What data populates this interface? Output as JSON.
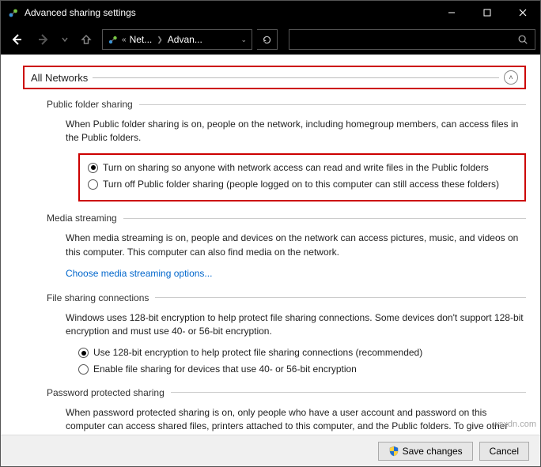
{
  "window": {
    "title": "Advanced sharing settings"
  },
  "nav": {
    "breadcrumb": {
      "part1": "Net...",
      "part2": "Advan..."
    }
  },
  "accordion": {
    "title": "All Networks"
  },
  "sections": {
    "public_folder": {
      "title": "Public folder sharing",
      "desc": "When Public folder sharing is on, people on the network, including homegroup members, can access files in the Public folders.",
      "opt_on": "Turn on sharing so anyone with network access can read and write files in the Public folders",
      "opt_off": "Turn off Public folder sharing (people logged on to this computer can still access these folders)"
    },
    "media": {
      "title": "Media streaming",
      "desc": "When media streaming is on, people and devices on the network can access pictures, music, and videos on this computer. This computer can also find media on the network.",
      "link": "Choose media streaming options..."
    },
    "file_sharing": {
      "title": "File sharing connections",
      "desc": "Windows uses 128-bit encryption to help protect file sharing connections. Some devices don't support 128-bit encryption and must use 40- or 56-bit encryption.",
      "opt_128": "Use 128-bit encryption to help protect file sharing connections (recommended)",
      "opt_40": "Enable file sharing for devices that use 40- or 56-bit encryption"
    },
    "password": {
      "title": "Password protected sharing",
      "desc": "When password protected sharing is on, only people who have a user account and password on this computer can access shared files, printers attached to this computer, and the Public folders. To give other people access, you must turn off password protected sharing."
    }
  },
  "footer": {
    "save": "Save changes",
    "cancel": "Cancel"
  },
  "watermark": "wsxdn.com"
}
